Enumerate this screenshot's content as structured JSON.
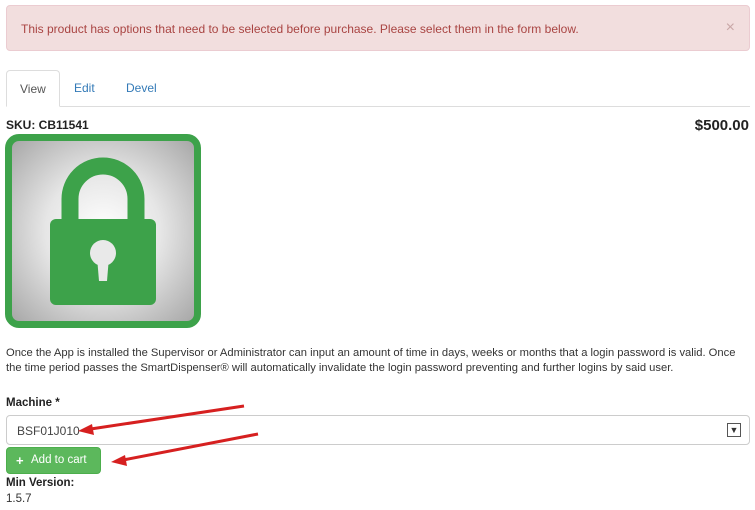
{
  "alert": {
    "message": "This product has options that need to be selected before purchase. Please select them in the form below.",
    "close": "×"
  },
  "tabs": [
    {
      "label": "View",
      "active": true
    },
    {
      "label": "Edit",
      "active": false
    },
    {
      "label": "Devel",
      "active": false
    }
  ],
  "product": {
    "sku": "SKU: CB11541",
    "price": "$500.00",
    "image_icon": "lock-icon",
    "description": "Once the App is installed the Supervisor or Administrator can input an amount of time in days, weeks or months that a login password is valid. Once the time period passes the SmartDispenser® will automatically invalidate the login password preventing and further logins by said user."
  },
  "form": {
    "machine_label": "Machine *",
    "machine_value": "BSF01J010",
    "add_to_cart_label": "Add to cart",
    "add_to_cart_icon": "+"
  },
  "meta": {
    "min_version_label": "Min Version:",
    "min_version_value": "1.5.7"
  },
  "colors": {
    "alert_bg": "#f2dede",
    "alert_text": "#a94442",
    "button_green": "#5cb85c",
    "lock_green": "#3da24a",
    "annotation_red": "#d62020"
  }
}
